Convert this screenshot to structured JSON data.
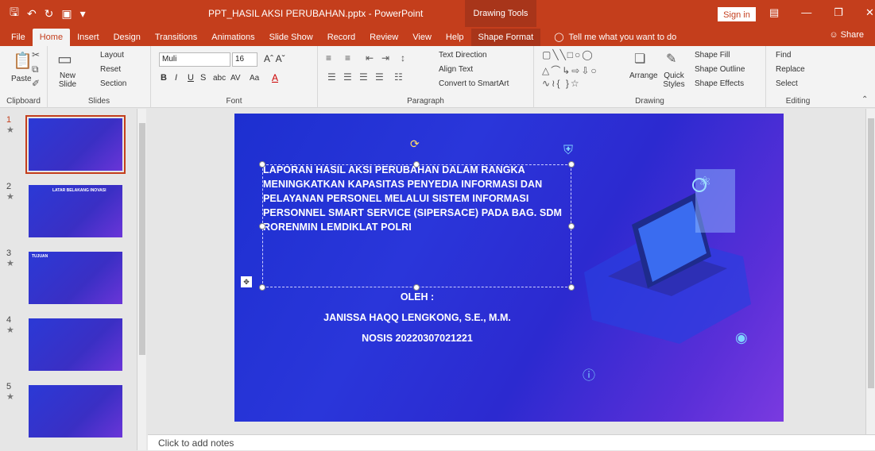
{
  "titlebar": {
    "doc_title": "PPT_HASIL AKSI PERUBAHAN.pptx  -  PowerPoint",
    "context_tab": "Drawing Tools",
    "signin": "Sign in"
  },
  "tabs": [
    "File",
    "Home",
    "Insert",
    "Design",
    "Transitions",
    "Animations",
    "Slide Show",
    "Record",
    "Review",
    "View",
    "Help",
    "Shape Format"
  ],
  "tell_me": "Tell me what you want to do",
  "share": "Share",
  "ribbon": {
    "clipboard": {
      "paste": "Paste",
      "label": "Clipboard"
    },
    "slides": {
      "new_slide": "New Slide",
      "layout": "Layout",
      "reset": "Reset",
      "section": "Section",
      "label": "Slides"
    },
    "font": {
      "font_name": "Muli",
      "font_size": "16",
      "label": "Font"
    },
    "paragraph": {
      "text_direction": "Text Direction",
      "align_text": "Align Text",
      "convert_smartart": "Convert to SmartArt",
      "label": "Paragraph"
    },
    "drawing": {
      "arrange": "Arrange",
      "quick_styles": "Quick Styles",
      "shape_fill": "Shape Fill",
      "shape_outline": "Shape Outline",
      "shape_effects": "Shape Effects",
      "label": "Drawing"
    },
    "editing": {
      "find": "Find",
      "replace": "Replace",
      "select": "Select",
      "label": "Editing"
    }
  },
  "thumbnails": [
    {
      "num": "1",
      "title": ""
    },
    {
      "num": "2",
      "title": "LATAR BELAKANG INOVASI"
    },
    {
      "num": "3",
      "title": "TUJUAN"
    },
    {
      "num": "4",
      "title": ""
    },
    {
      "num": "5",
      "title": ""
    }
  ],
  "slide": {
    "title": "LAPORAN HASIL AKSI PERUBAHAN DALAM RANGKA MENINGKATKAN KAPASITAS PENYEDIA INFORMASI DAN PELAYANAN PERSONEL MELALUI SISTEM INFORMASI PERSONNEL SMART  SERVICE (SIPERSACE) PADA BAG. SDM RORENMIN LEMDIKLAT POLRI",
    "oleh": "OLEH :",
    "author": "JANISSA HAQQ LENGKONG, S.E., M.M.",
    "nosis": "NOSIS 20220307021221"
  },
  "notes_placeholder": "Click to add notes",
  "colors": {
    "accent": "#c43e1c",
    "slide_bg": "#2a36da"
  }
}
